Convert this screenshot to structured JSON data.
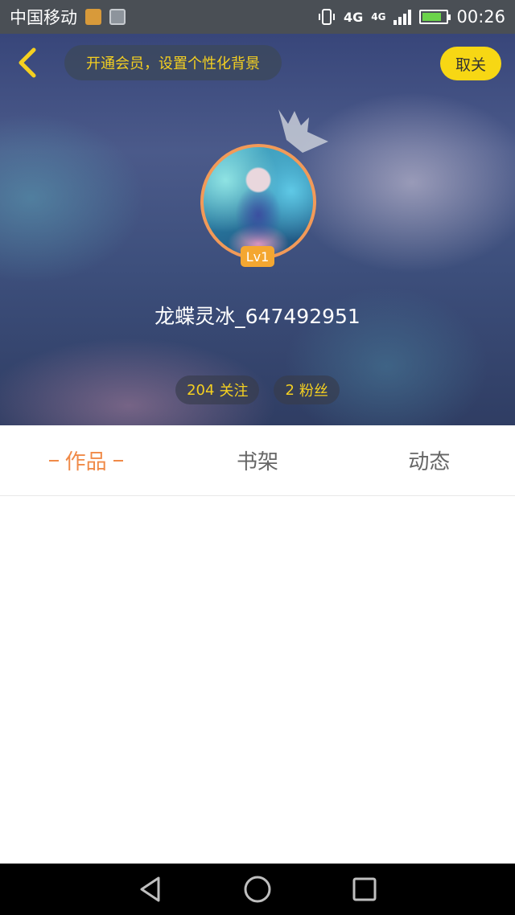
{
  "status_bar": {
    "carrier": "中国移动",
    "network_1": "4G",
    "network_2": "4G",
    "time": "00:26"
  },
  "header": {
    "vip_prompt": "开通会员，设置个性化背景",
    "unfollow_label": "取关"
  },
  "profile": {
    "level": "Lv1",
    "username": "龙蝶灵冰_647492951",
    "following_count": "204",
    "following_label": "关注",
    "followers_count": "2",
    "followers_label": "粉丝"
  },
  "tabs": [
    {
      "label": "作品",
      "active": true
    },
    {
      "label": "书架",
      "active": false
    },
    {
      "label": "动态",
      "active": false
    }
  ],
  "colors": {
    "accent": "#f08a48",
    "vip_yellow": "#f5d020",
    "button_yellow": "#f7d714"
  },
  "icons": {
    "back": "chevron-left-icon",
    "crown": "crown-icon",
    "nav_back": "triangle-back-icon",
    "nav_home": "circle-home-icon",
    "nav_recent": "square-recent-icon"
  }
}
